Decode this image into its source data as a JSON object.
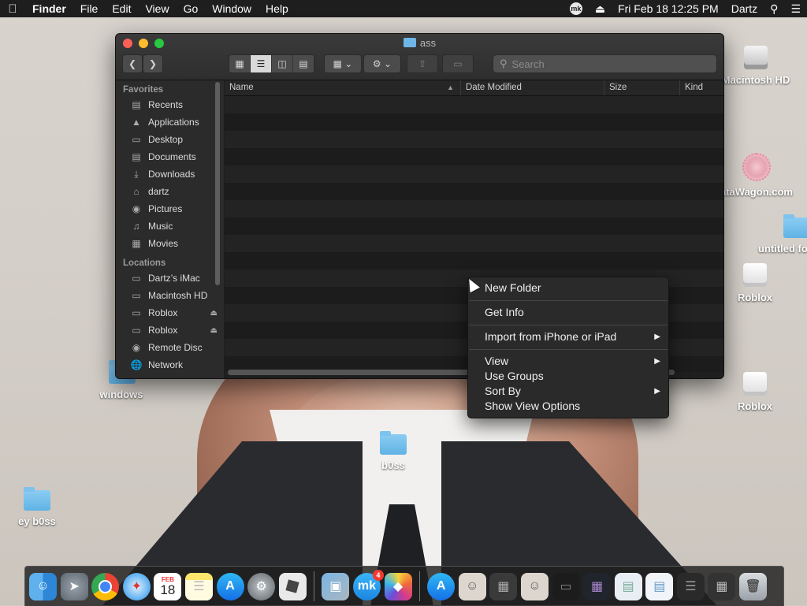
{
  "menubar": {
    "app_name": "Finder",
    "menus": [
      "File",
      "Edit",
      "View",
      "Go",
      "Window",
      "Help"
    ],
    "status_mk": "mk",
    "datetime": "Fri Feb 18  12:25 PM",
    "user": "Dartz"
  },
  "desktop": {
    "icons": [
      {
        "label": "Macintosh HD"
      },
      {
        "label": "ataWagon.com"
      },
      {
        "label": "untitled fo"
      },
      {
        "label": "Roblox"
      },
      {
        "label": "Roblox"
      },
      {
        "label": "windows"
      },
      {
        "label": "b0ss"
      },
      {
        "label": "ey b0ss"
      }
    ]
  },
  "finder": {
    "title": "ass",
    "search_placeholder": "Search",
    "sidebar": {
      "favorites_header": "Favorites",
      "favorites": [
        {
          "label": "Recents",
          "icon": "recents-icon"
        },
        {
          "label": "Applications",
          "icon": "applications-icon"
        },
        {
          "label": "Desktop",
          "icon": "desktop-icon"
        },
        {
          "label": "Documents",
          "icon": "documents-icon"
        },
        {
          "label": "Downloads",
          "icon": "downloads-icon"
        },
        {
          "label": "dartz",
          "icon": "home-icon"
        },
        {
          "label": "Pictures",
          "icon": "pictures-icon"
        },
        {
          "label": "Music",
          "icon": "music-icon"
        },
        {
          "label": "Movies",
          "icon": "movies-icon"
        }
      ],
      "locations_header": "Locations",
      "locations": [
        {
          "label": "Dartz’s iMac",
          "icon": "imac-icon"
        },
        {
          "label": "Macintosh HD",
          "icon": "disk-icon"
        },
        {
          "label": "Roblox",
          "icon": "disk-icon",
          "eject": true
        },
        {
          "label": "Roblox",
          "icon": "disk-icon",
          "eject": true
        },
        {
          "label": "Remote Disc",
          "icon": "disc-icon"
        },
        {
          "label": "Network",
          "icon": "network-icon"
        }
      ]
    },
    "columns": {
      "name": "Name",
      "date_modified": "Date Modified",
      "size": "Size",
      "kind": "Kind"
    }
  },
  "context_menu": {
    "new_folder": "New Folder",
    "get_info": "Get Info",
    "import": "Import from iPhone or iPad",
    "view": "View",
    "use_groups": "Use Groups",
    "sort_by": "Sort By",
    "show_view_options": "Show View Options"
  },
  "dock": {
    "calendar_month": "FEB",
    "calendar_day": "18",
    "mk_badge": "4",
    "mk_label": "mk"
  },
  "colors": {
    "menubar_bg": "#1e1e1e",
    "window_bg": "#1e1e1e",
    "accent_close": "#fc5f57",
    "accent_min": "#fdbc2e",
    "accent_zoom": "#28c840",
    "folder_blue": "#6fb6e8"
  }
}
